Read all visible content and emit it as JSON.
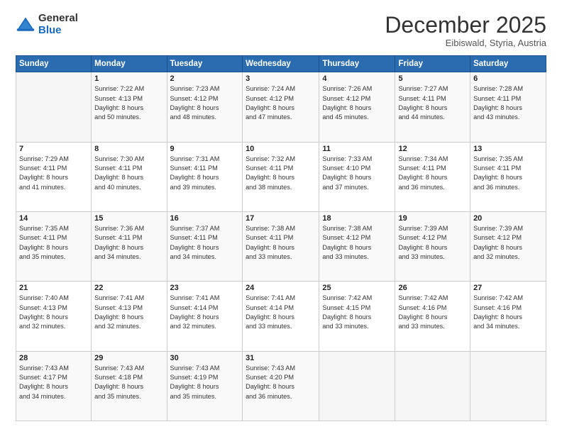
{
  "header": {
    "logo_general": "General",
    "logo_blue": "Blue",
    "month_title": "December 2025",
    "location": "Eibiswald, Styria, Austria"
  },
  "days_of_week": [
    "Sunday",
    "Monday",
    "Tuesday",
    "Wednesday",
    "Thursday",
    "Friday",
    "Saturday"
  ],
  "weeks": [
    [
      {
        "day": "",
        "info": ""
      },
      {
        "day": "1",
        "info": "Sunrise: 7:22 AM\nSunset: 4:13 PM\nDaylight: 8 hours\nand 50 minutes."
      },
      {
        "day": "2",
        "info": "Sunrise: 7:23 AM\nSunset: 4:12 PM\nDaylight: 8 hours\nand 48 minutes."
      },
      {
        "day": "3",
        "info": "Sunrise: 7:24 AM\nSunset: 4:12 PM\nDaylight: 8 hours\nand 47 minutes."
      },
      {
        "day": "4",
        "info": "Sunrise: 7:26 AM\nSunset: 4:12 PM\nDaylight: 8 hours\nand 45 minutes."
      },
      {
        "day": "5",
        "info": "Sunrise: 7:27 AM\nSunset: 4:11 PM\nDaylight: 8 hours\nand 44 minutes."
      },
      {
        "day": "6",
        "info": "Sunrise: 7:28 AM\nSunset: 4:11 PM\nDaylight: 8 hours\nand 43 minutes."
      }
    ],
    [
      {
        "day": "7",
        "info": "Sunrise: 7:29 AM\nSunset: 4:11 PM\nDaylight: 8 hours\nand 41 minutes."
      },
      {
        "day": "8",
        "info": "Sunrise: 7:30 AM\nSunset: 4:11 PM\nDaylight: 8 hours\nand 40 minutes."
      },
      {
        "day": "9",
        "info": "Sunrise: 7:31 AM\nSunset: 4:11 PM\nDaylight: 8 hours\nand 39 minutes."
      },
      {
        "day": "10",
        "info": "Sunrise: 7:32 AM\nSunset: 4:11 PM\nDaylight: 8 hours\nand 38 minutes."
      },
      {
        "day": "11",
        "info": "Sunrise: 7:33 AM\nSunset: 4:10 PM\nDaylight: 8 hours\nand 37 minutes."
      },
      {
        "day": "12",
        "info": "Sunrise: 7:34 AM\nSunset: 4:11 PM\nDaylight: 8 hours\nand 36 minutes."
      },
      {
        "day": "13",
        "info": "Sunrise: 7:35 AM\nSunset: 4:11 PM\nDaylight: 8 hours\nand 36 minutes."
      }
    ],
    [
      {
        "day": "14",
        "info": "Sunrise: 7:35 AM\nSunset: 4:11 PM\nDaylight: 8 hours\nand 35 minutes."
      },
      {
        "day": "15",
        "info": "Sunrise: 7:36 AM\nSunset: 4:11 PM\nDaylight: 8 hours\nand 34 minutes."
      },
      {
        "day": "16",
        "info": "Sunrise: 7:37 AM\nSunset: 4:11 PM\nDaylight: 8 hours\nand 34 minutes."
      },
      {
        "day": "17",
        "info": "Sunrise: 7:38 AM\nSunset: 4:11 PM\nDaylight: 8 hours\nand 33 minutes."
      },
      {
        "day": "18",
        "info": "Sunrise: 7:38 AM\nSunset: 4:12 PM\nDaylight: 8 hours\nand 33 minutes."
      },
      {
        "day": "19",
        "info": "Sunrise: 7:39 AM\nSunset: 4:12 PM\nDaylight: 8 hours\nand 33 minutes."
      },
      {
        "day": "20",
        "info": "Sunrise: 7:39 AM\nSunset: 4:12 PM\nDaylight: 8 hours\nand 32 minutes."
      }
    ],
    [
      {
        "day": "21",
        "info": "Sunrise: 7:40 AM\nSunset: 4:13 PM\nDaylight: 8 hours\nand 32 minutes."
      },
      {
        "day": "22",
        "info": "Sunrise: 7:41 AM\nSunset: 4:13 PM\nDaylight: 8 hours\nand 32 minutes."
      },
      {
        "day": "23",
        "info": "Sunrise: 7:41 AM\nSunset: 4:14 PM\nDaylight: 8 hours\nand 32 minutes."
      },
      {
        "day": "24",
        "info": "Sunrise: 7:41 AM\nSunset: 4:14 PM\nDaylight: 8 hours\nand 33 minutes."
      },
      {
        "day": "25",
        "info": "Sunrise: 7:42 AM\nSunset: 4:15 PM\nDaylight: 8 hours\nand 33 minutes."
      },
      {
        "day": "26",
        "info": "Sunrise: 7:42 AM\nSunset: 4:16 PM\nDaylight: 8 hours\nand 33 minutes."
      },
      {
        "day": "27",
        "info": "Sunrise: 7:42 AM\nSunset: 4:16 PM\nDaylight: 8 hours\nand 34 minutes."
      }
    ],
    [
      {
        "day": "28",
        "info": "Sunrise: 7:43 AM\nSunset: 4:17 PM\nDaylight: 8 hours\nand 34 minutes."
      },
      {
        "day": "29",
        "info": "Sunrise: 7:43 AM\nSunset: 4:18 PM\nDaylight: 8 hours\nand 35 minutes."
      },
      {
        "day": "30",
        "info": "Sunrise: 7:43 AM\nSunset: 4:19 PM\nDaylight: 8 hours\nand 35 minutes."
      },
      {
        "day": "31",
        "info": "Sunrise: 7:43 AM\nSunset: 4:20 PM\nDaylight: 8 hours\nand 36 minutes."
      },
      {
        "day": "",
        "info": ""
      },
      {
        "day": "",
        "info": ""
      },
      {
        "day": "",
        "info": ""
      }
    ]
  ]
}
